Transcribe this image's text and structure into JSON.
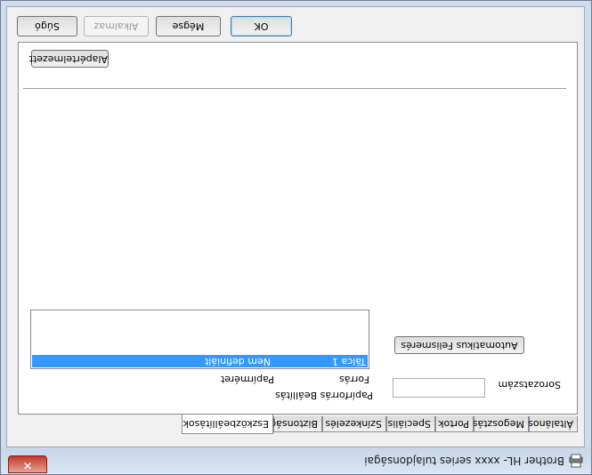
{
  "window": {
    "title": "Brother HL- xxxx series tulajdonságai",
    "close_symbol": "✕",
    "app_icon": "printer-icon"
  },
  "tabs": [
    {
      "label": "Általános",
      "active": false
    },
    {
      "label": "Megosztás",
      "active": false
    },
    {
      "label": "Portok",
      "active": false
    },
    {
      "label": "Speciális",
      "active": false
    },
    {
      "label": "Színkezelés",
      "active": false
    },
    {
      "label": "Biztonság",
      "active": false
    },
    {
      "label": "Eszközbeállítások",
      "active": true
    }
  ],
  "device_settings": {
    "paper_source_setting_label": "Papírforrás Beállítás",
    "source_column": "Forrás",
    "paper_size_column": "Papírméret",
    "rows": [
      {
        "source": "Tálca 1",
        "paper_size": "Nem definiált"
      }
    ],
    "auto_detect_button": "Automatikus Felismerés",
    "serial_label": "Sorozatszám",
    "serial_value": "",
    "default_button": "Alapértelmezett"
  },
  "footer": {
    "ok": "OK",
    "cancel": "Mégse",
    "apply": "Alkalmaz",
    "help": "Súgó"
  },
  "colors": {
    "selection": "#3399ff",
    "close_button": "#c3392a",
    "frame": "#cfdcec"
  }
}
